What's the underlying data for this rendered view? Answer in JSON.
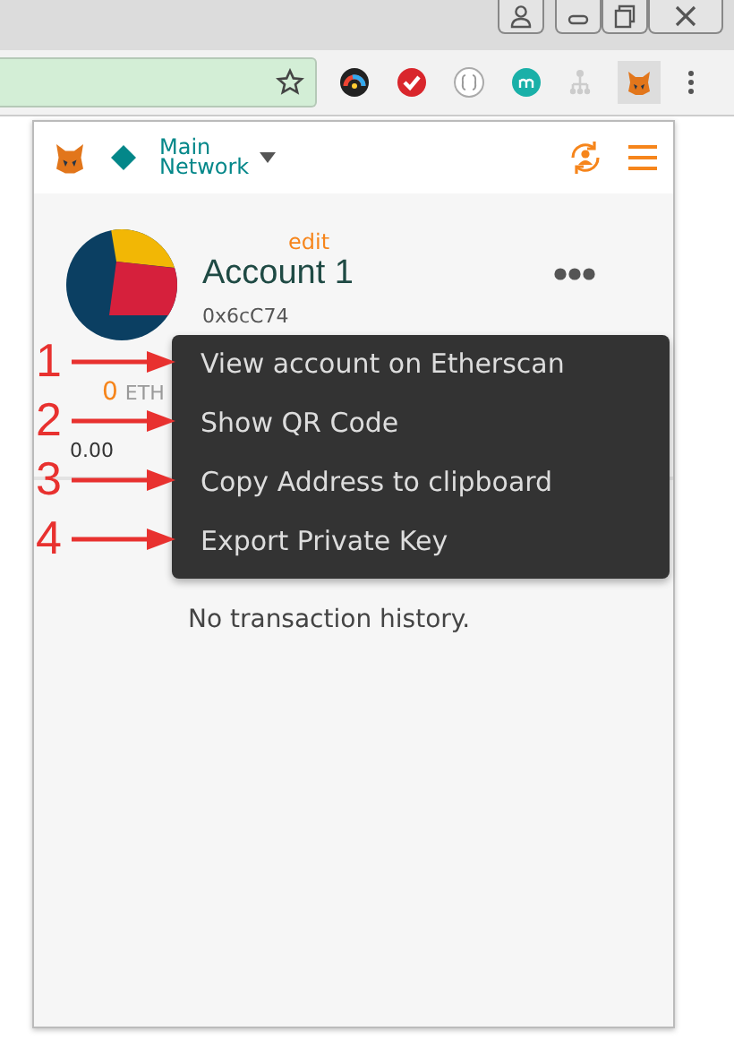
{
  "popup": {
    "network": [
      "Main",
      "Network"
    ],
    "account": {
      "edit_link": "edit",
      "name": "Account 1",
      "address": "0x6cC74",
      "balance": {
        "amount": "0",
        "unit": "ETH",
        "fiat": "0.00"
      }
    },
    "account_menu": {
      "items": [
        "View account on Etherscan",
        "Show QR Code",
        "Copy Address to clipboard",
        "Export Private Key"
      ]
    },
    "history": {
      "empty_text": "No transaction history."
    }
  },
  "annotations": [
    "1",
    "2",
    "3",
    "4"
  ]
}
